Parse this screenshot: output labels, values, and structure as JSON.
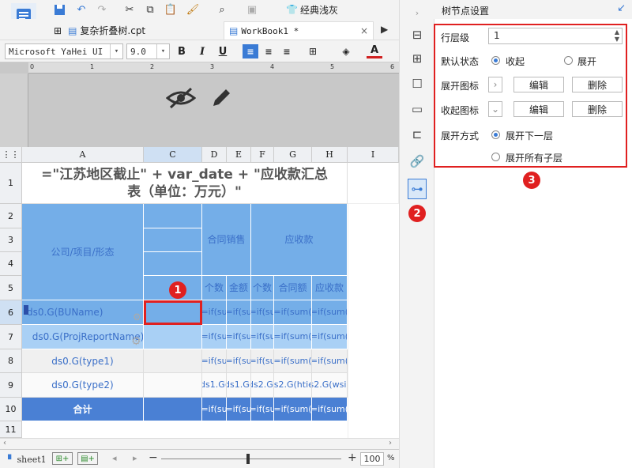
{
  "toolbar": {
    "theme_label": "经典浅灰"
  },
  "tabs": [
    {
      "label": "复杂折叠树.cpt"
    },
    {
      "label": "WorkBook1 *"
    }
  ],
  "format": {
    "font_name": "Microsoft YaHei UI",
    "font_size": "9.0",
    "bold": "B",
    "italic": "I",
    "underline": "U"
  },
  "ruler": {
    "marks": [
      "0",
      "1",
      "2",
      "3",
      "4",
      "5",
      "6"
    ]
  },
  "grid": {
    "columns": [
      "A",
      "C",
      "D",
      "E",
      "F",
      "G",
      "H",
      "I"
    ],
    "rows": [
      "1",
      "2",
      "3",
      "4",
      "5",
      "6",
      "7",
      "8",
      "9",
      "10",
      "11"
    ],
    "title": "=\"江苏地区截止\" + var_date + \"应收款汇总表（单位：万元）\"",
    "header_company": "公司/项目/形态",
    "header_contract": "合同销售",
    "header_receivable": "应收款",
    "sub_count1": "个数",
    "sub_amount": "金额",
    "sub_count2": "个数",
    "sub_contract_amount": "合同额",
    "sub_receivable": "应收款",
    "r6_a": "ds0.G(BUName)",
    "r7_a": "ds0.G(ProjReportName)",
    "r8_a": "ds0.G(type1)",
    "r9_a": "ds0.G(type2)",
    "r10_a": "合计",
    "f_if_su": "=if(su",
    "f_if_sum": "=if(sum(",
    "r9_d": "ds1.G(",
    "r9_e": "ds1.G(",
    "r9_f": "ds2.G(",
    "r9_g": "ds2.G(htie)",
    "r9_h": "ds2.G(wsie)"
  },
  "bottom": {
    "sheet_name": "sheet1",
    "zoom": "100",
    "percent": "%"
  },
  "panel": {
    "title": "树节点设置",
    "level_label": "行层级",
    "level_value": "1",
    "default_state_label": "默认状态",
    "opt_collapse": "收起",
    "opt_expand": "展开",
    "expand_icon_label": "展开图标",
    "collapse_icon_label": "收起图标",
    "edit": "编辑",
    "delete": "删除",
    "expand_mode_label": "展开方式",
    "opt_next_level": "展开下一层",
    "opt_all_children": "展开所有子层"
  },
  "markers": {
    "m1": "1",
    "m2": "2",
    "m3": "3"
  },
  "colors": {
    "accent": "#3a7bd5",
    "highlight": "#e02020",
    "header_blue": "#74aee8"
  }
}
